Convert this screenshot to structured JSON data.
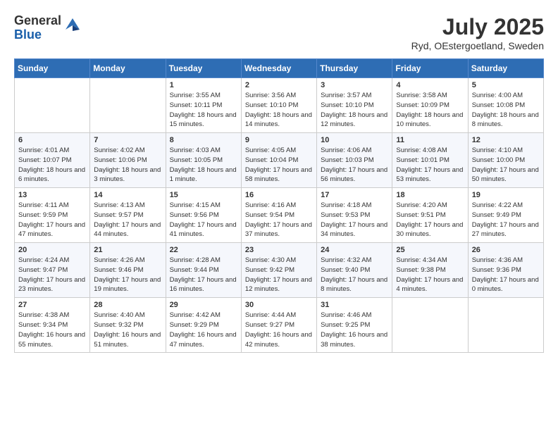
{
  "header": {
    "logo_general": "General",
    "logo_blue": "Blue",
    "month_title": "July 2025",
    "location": "Ryd, OEstergoetland, Sweden"
  },
  "days_of_week": [
    "Sunday",
    "Monday",
    "Tuesday",
    "Wednesday",
    "Thursday",
    "Friday",
    "Saturday"
  ],
  "weeks": [
    [
      {
        "day": "",
        "info": ""
      },
      {
        "day": "",
        "info": ""
      },
      {
        "day": "1",
        "info": "Sunrise: 3:55 AM\nSunset: 10:11 PM\nDaylight: 18 hours and 15 minutes."
      },
      {
        "day": "2",
        "info": "Sunrise: 3:56 AM\nSunset: 10:10 PM\nDaylight: 18 hours and 14 minutes."
      },
      {
        "day": "3",
        "info": "Sunrise: 3:57 AM\nSunset: 10:10 PM\nDaylight: 18 hours and 12 minutes."
      },
      {
        "day": "4",
        "info": "Sunrise: 3:58 AM\nSunset: 10:09 PM\nDaylight: 18 hours and 10 minutes."
      },
      {
        "day": "5",
        "info": "Sunrise: 4:00 AM\nSunset: 10:08 PM\nDaylight: 18 hours and 8 minutes."
      }
    ],
    [
      {
        "day": "6",
        "info": "Sunrise: 4:01 AM\nSunset: 10:07 PM\nDaylight: 18 hours and 6 minutes."
      },
      {
        "day": "7",
        "info": "Sunrise: 4:02 AM\nSunset: 10:06 PM\nDaylight: 18 hours and 3 minutes."
      },
      {
        "day": "8",
        "info": "Sunrise: 4:03 AM\nSunset: 10:05 PM\nDaylight: 18 hours and 1 minute."
      },
      {
        "day": "9",
        "info": "Sunrise: 4:05 AM\nSunset: 10:04 PM\nDaylight: 17 hours and 58 minutes."
      },
      {
        "day": "10",
        "info": "Sunrise: 4:06 AM\nSunset: 10:03 PM\nDaylight: 17 hours and 56 minutes."
      },
      {
        "day": "11",
        "info": "Sunrise: 4:08 AM\nSunset: 10:01 PM\nDaylight: 17 hours and 53 minutes."
      },
      {
        "day": "12",
        "info": "Sunrise: 4:10 AM\nSunset: 10:00 PM\nDaylight: 17 hours and 50 minutes."
      }
    ],
    [
      {
        "day": "13",
        "info": "Sunrise: 4:11 AM\nSunset: 9:59 PM\nDaylight: 17 hours and 47 minutes."
      },
      {
        "day": "14",
        "info": "Sunrise: 4:13 AM\nSunset: 9:57 PM\nDaylight: 17 hours and 44 minutes."
      },
      {
        "day": "15",
        "info": "Sunrise: 4:15 AM\nSunset: 9:56 PM\nDaylight: 17 hours and 41 minutes."
      },
      {
        "day": "16",
        "info": "Sunrise: 4:16 AM\nSunset: 9:54 PM\nDaylight: 17 hours and 37 minutes."
      },
      {
        "day": "17",
        "info": "Sunrise: 4:18 AM\nSunset: 9:53 PM\nDaylight: 17 hours and 34 minutes."
      },
      {
        "day": "18",
        "info": "Sunrise: 4:20 AM\nSunset: 9:51 PM\nDaylight: 17 hours and 30 minutes."
      },
      {
        "day": "19",
        "info": "Sunrise: 4:22 AM\nSunset: 9:49 PM\nDaylight: 17 hours and 27 minutes."
      }
    ],
    [
      {
        "day": "20",
        "info": "Sunrise: 4:24 AM\nSunset: 9:47 PM\nDaylight: 17 hours and 23 minutes."
      },
      {
        "day": "21",
        "info": "Sunrise: 4:26 AM\nSunset: 9:46 PM\nDaylight: 17 hours and 19 minutes."
      },
      {
        "day": "22",
        "info": "Sunrise: 4:28 AM\nSunset: 9:44 PM\nDaylight: 17 hours and 16 minutes."
      },
      {
        "day": "23",
        "info": "Sunrise: 4:30 AM\nSunset: 9:42 PM\nDaylight: 17 hours and 12 minutes."
      },
      {
        "day": "24",
        "info": "Sunrise: 4:32 AM\nSunset: 9:40 PM\nDaylight: 17 hours and 8 minutes."
      },
      {
        "day": "25",
        "info": "Sunrise: 4:34 AM\nSunset: 9:38 PM\nDaylight: 17 hours and 4 minutes."
      },
      {
        "day": "26",
        "info": "Sunrise: 4:36 AM\nSunset: 9:36 PM\nDaylight: 17 hours and 0 minutes."
      }
    ],
    [
      {
        "day": "27",
        "info": "Sunrise: 4:38 AM\nSunset: 9:34 PM\nDaylight: 16 hours and 55 minutes."
      },
      {
        "day": "28",
        "info": "Sunrise: 4:40 AM\nSunset: 9:32 PM\nDaylight: 16 hours and 51 minutes."
      },
      {
        "day": "29",
        "info": "Sunrise: 4:42 AM\nSunset: 9:29 PM\nDaylight: 16 hours and 47 minutes."
      },
      {
        "day": "30",
        "info": "Sunrise: 4:44 AM\nSunset: 9:27 PM\nDaylight: 16 hours and 42 minutes."
      },
      {
        "day": "31",
        "info": "Sunrise: 4:46 AM\nSunset: 9:25 PM\nDaylight: 16 hours and 38 minutes."
      },
      {
        "day": "",
        "info": ""
      },
      {
        "day": "",
        "info": ""
      }
    ]
  ]
}
